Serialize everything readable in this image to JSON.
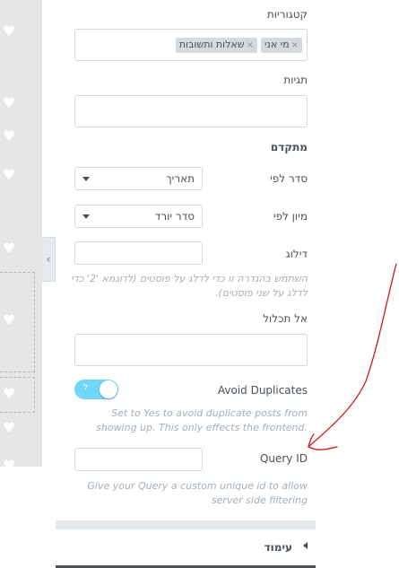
{
  "panel": {
    "categories": {
      "label": "קטגוריות",
      "chips": [
        {
          "text": "מי אני",
          "remove": "×"
        },
        {
          "text": "שאלות ותשובות",
          "remove": "×"
        }
      ]
    },
    "tags": {
      "label": "תגיות",
      "value": ""
    },
    "advanced_title": "מתקדם",
    "order_by": {
      "label": "סדר לפי",
      "value": "תאריך"
    },
    "order": {
      "label": "מיון לפי",
      "value": "סדר יורד"
    },
    "offset": {
      "label": "דילוג",
      "value": "",
      "help": "השתמש בהגדרה זו כדי לדלג על פוסטים (לדוגמא '2' כדי לדלג על שני פוסטים)."
    },
    "exclude": {
      "label": "אל תכלול",
      "value": ""
    },
    "avoid_duplicates": {
      "label": "Avoid Duplicates",
      "toggle_text": "ל",
      "on": true,
      "help": "Set to Yes to avoid duplicate posts from showing up. This only effects the frontend."
    },
    "query_id": {
      "label": "Query ID",
      "value": "",
      "help": "Give your Query a custom unique id to allow server side filtering"
    },
    "section": {
      "label": "עימוד"
    }
  },
  "colors": {
    "toggle_on": "#71d7f7",
    "annotation": "#d6151b",
    "panel_border": "#d5dadf"
  },
  "icons": {
    "collapse": "chevron-left-icon",
    "section_arrow": "caret-left-icon",
    "heart": "heart-icon"
  }
}
